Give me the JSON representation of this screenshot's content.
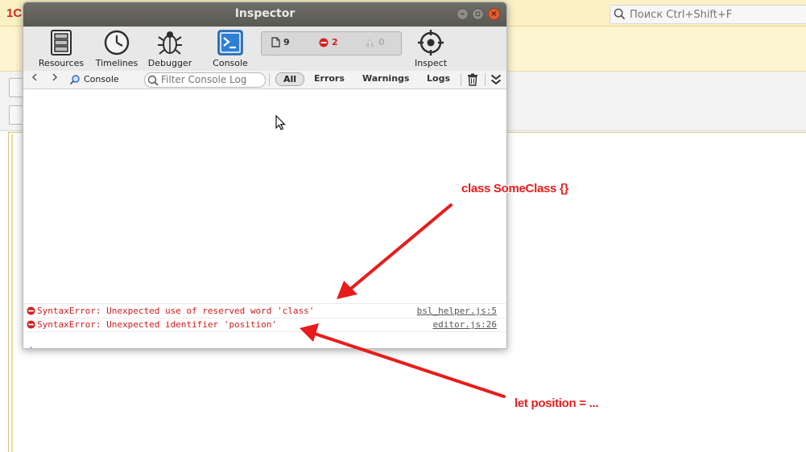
{
  "app": {
    "logo": "1С",
    "search_placeholder": "Поиск Ctrl+Shift+F"
  },
  "inspector": {
    "title": "Inspector",
    "toolbar": {
      "resources": "Resources",
      "timelines": "Timelines",
      "debugger": "Debugger",
      "console": "Console",
      "inspect": "Inspect"
    },
    "counters": {
      "logs": "9",
      "errors": "2",
      "warnings": "0"
    },
    "filterbar": {
      "scope": "Console",
      "filter_placeholder": "Filter Console Log",
      "all": "All",
      "errors": "Errors",
      "warnings": "Warnings",
      "logs": "Logs"
    },
    "messages": [
      {
        "text": "SyntaxError: Unexpected use of reserved word 'class'",
        "source": "bsl_helper.js:5"
      },
      {
        "text": "SyntaxError: Unexpected identifier 'position'",
        "source": "editor.js:26"
      }
    ],
    "prompt": "›"
  },
  "annotations": {
    "first": "class SomeClass {}",
    "second": "let position = ..."
  },
  "colors": {
    "error": "#d41a1a",
    "annotation": "#e81c1c",
    "titlebar": "#5f5e59",
    "console_accent": "#2f7fd4"
  }
}
